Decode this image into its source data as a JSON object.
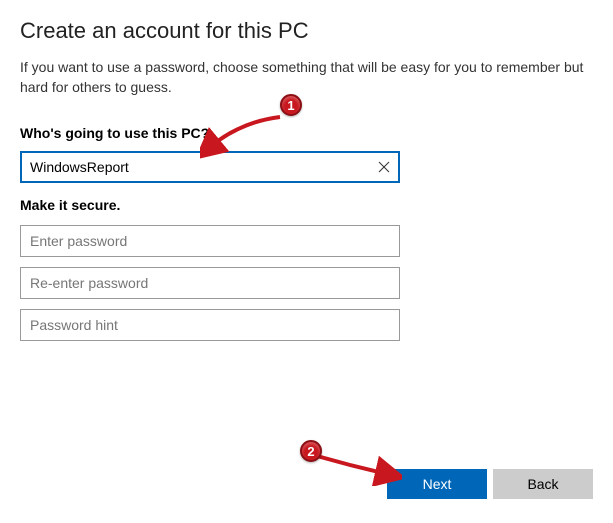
{
  "title": "Create an account for this PC",
  "subtitle": "If you want to use a password, choose something that will be easy for you to remember but hard for others to guess.",
  "section_user_label": "Who's going to use this PC?",
  "username_value": "WindowsReport",
  "section_secure_label": "Make it secure.",
  "placeholders": {
    "password": "Enter password",
    "reenter": "Re-enter password",
    "hint": "Password hint"
  },
  "buttons": {
    "next": "Next",
    "back": "Back"
  },
  "annotations": {
    "marker1": "1",
    "marker2": "2"
  }
}
